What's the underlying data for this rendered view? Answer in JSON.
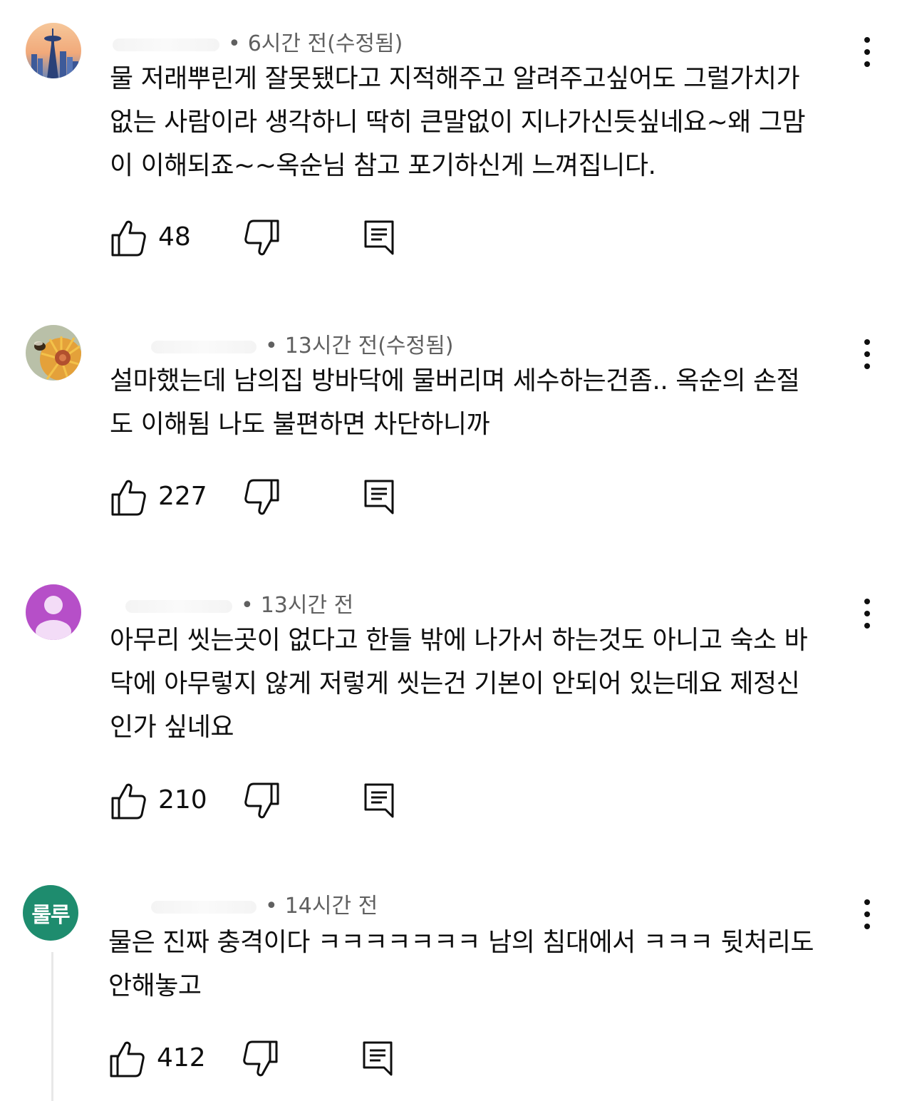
{
  "colors": {
    "text": "#0f0f0f",
    "meta": "#606060",
    "avatar_green": "#1e8c6e",
    "avatar_purple": "#b64fc8"
  },
  "comments": [
    {
      "avatar": "space-needle-avatar",
      "time": "6시간 전(수정됨)",
      "text": "물 저래뿌린게 잘못됐다고 지적해주고 알려주고싶어도 그럴가치가\n없는 사람이라 생각하니 딱히 큰말없이 지나가신듯싶네요~왜 그맘\n이 이해되죠~~옥순님 참고 포기하신게 느껴집니다.",
      "likes": "48"
    },
    {
      "avatar": "flower-bee-avatar",
      "time": "13시간 전(수정됨)",
      "text": "설마했는데 남의집 방바닥에 물버리며 세수하는건좀..  옥순의 손절\n도 이해됨 나도 불편하면 차단하니까",
      "likes": "227"
    },
    {
      "avatar": "default-person-avatar",
      "time": "13시간 전",
      "text": "아무리 씻는곳이 없다고 한들 밖에 나가서 하는것도 아니고 숙소 바\n닥에 아무렇지 않게 저렇게 씻는건 기본이 안되어 있는데요 제정신\n인가 싶네요",
      "likes": "210"
    },
    {
      "avatar_text": "룰루",
      "time": "14시간 전",
      "text": "물은 진짜 충격이다 ㅋㅋㅋㅋㅋㅋㅋ 남의 침대에서 ㅋㅋㅋ 뒷처리도\n안해놓고",
      "likes": "412"
    }
  ]
}
